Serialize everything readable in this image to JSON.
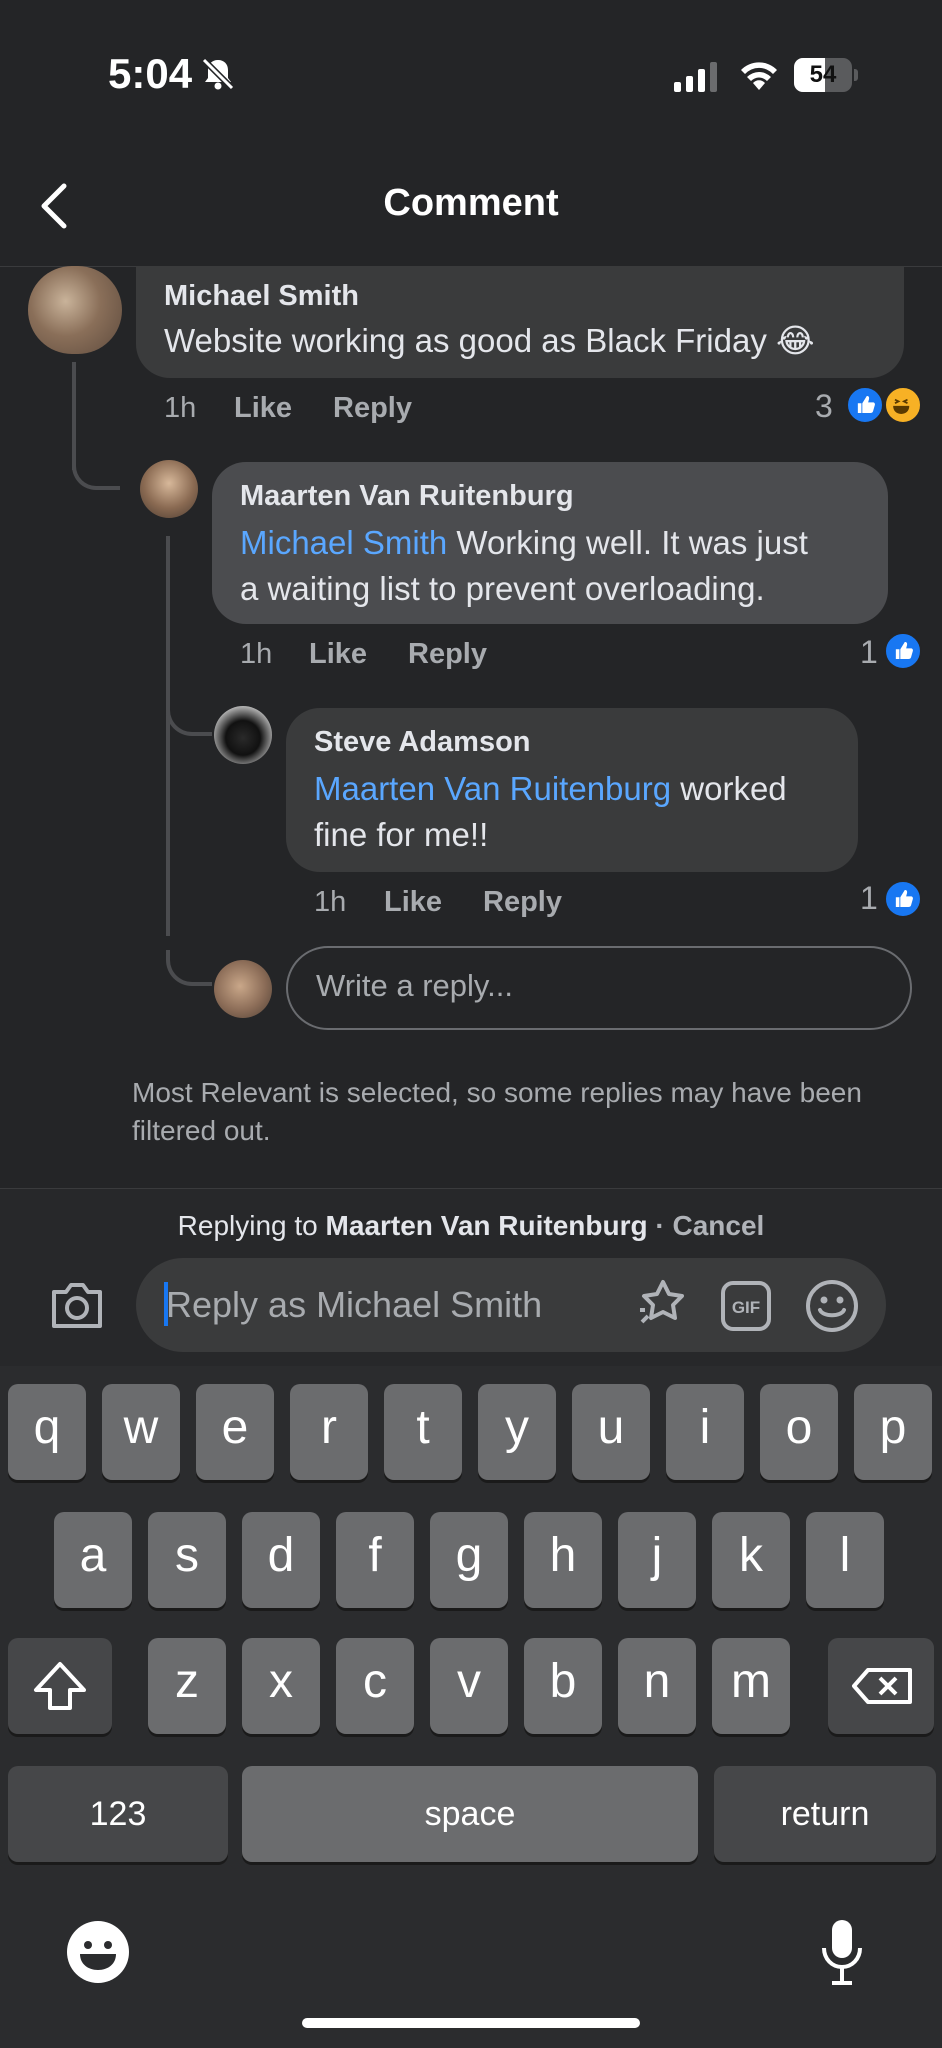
{
  "status_bar": {
    "time": "5:04",
    "battery": "54",
    "battery_level": 0.54
  },
  "header": {
    "title": "Comment"
  },
  "comments": [
    {
      "author": "Michael Smith",
      "mention": "",
      "text": "Website working as good as Black Friday 😂",
      "time": "1h",
      "like_label": "Like",
      "reply_label": "Reply",
      "reaction_count": "3",
      "reactions": [
        "like-icon",
        "haha-icon"
      ]
    },
    {
      "author": "Maarten Van Ruitenburg",
      "mention": "Michael Smith",
      "text_line1": "Working well. It was just",
      "text_line2": "a waiting list to prevent overloading.",
      "time": "1h",
      "like_label": "Like",
      "reply_label": "Reply",
      "reaction_count": "1",
      "reactions": [
        "like-icon"
      ]
    },
    {
      "author": "Steve Adamson",
      "mention": "Maarten Van Ruitenburg",
      "text_line1": "worked",
      "text_line2": "fine for me!!",
      "time": "1h",
      "like_label": "Like",
      "reply_label": "Reply",
      "reaction_count": "1",
      "reactions": [
        "like-icon"
      ]
    }
  ],
  "reply_field": {
    "placeholder": "Write a reply..."
  },
  "filter_note": "Most Relevant is selected, so some replies may have been filtered out.",
  "composer": {
    "replying_prefix": "Replying to",
    "replying_name": "Maarten Van Ruitenburg",
    "separator": "·",
    "cancel_label": "Cancel",
    "placeholder": "Reply as Michael Smith"
  },
  "keyboard": {
    "row1": [
      "q",
      "w",
      "e",
      "r",
      "t",
      "y",
      "u",
      "i",
      "o",
      "p"
    ],
    "row2": [
      "a",
      "s",
      "d",
      "f",
      "g",
      "h",
      "j",
      "k",
      "l"
    ],
    "row3": [
      "z",
      "x",
      "c",
      "v",
      "b",
      "n",
      "m"
    ],
    "numbers_label": "123",
    "space_label": "space",
    "return_label": "return"
  },
  "colors": {
    "accent": "#1877f2",
    "mention": "#5aa7ff",
    "background": "#242527"
  }
}
